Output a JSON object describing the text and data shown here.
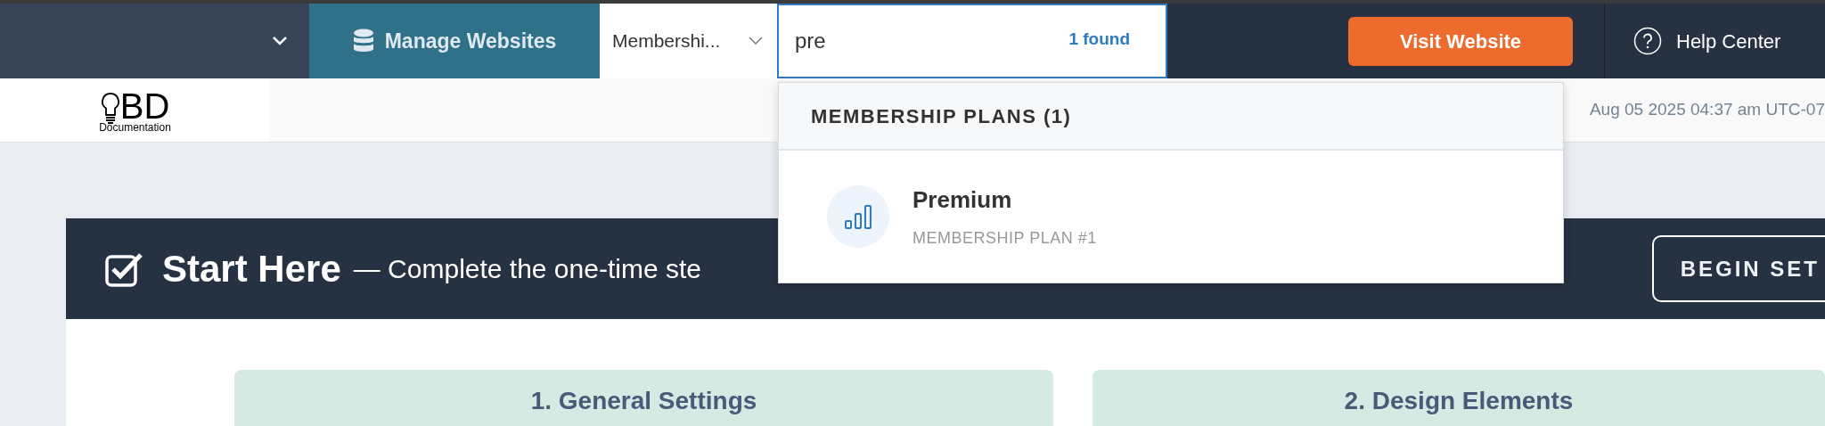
{
  "topbar": {
    "manage_websites": "Manage Websites",
    "section_select": {
      "value": "Membershi..."
    },
    "search": {
      "value": "pre",
      "result_count": "1 found"
    },
    "visit_button": "Visit Website",
    "help": "Help Center"
  },
  "subbar": {
    "logo": {
      "mark": "BD",
      "caption": "Documentation"
    },
    "timestamp": "Aug 05 2025 04:37 am UTC-07"
  },
  "search_results": {
    "groups": [
      {
        "heading": "MEMBERSHIP PLANS (1)",
        "items": [
          {
            "title": "Premium",
            "subtitle": "MEMBERSHIP PLAN #1"
          }
        ]
      }
    ]
  },
  "start_panel": {
    "title": "Start Here",
    "subtitle": "— Complete the one-time ste",
    "button": "BEGIN SET",
    "checked": true
  },
  "step_cards": [
    {
      "title": "1. General Settings"
    },
    {
      "title": "2. Design Elements"
    }
  ]
}
